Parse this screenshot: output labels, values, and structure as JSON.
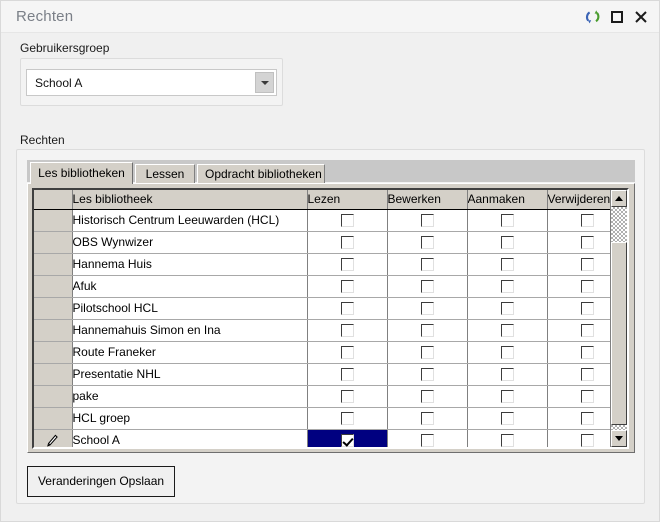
{
  "window": {
    "title": "Rechten",
    "controls": [
      {
        "name": "sync-icon",
        "label": "Sync"
      },
      {
        "name": "restore-icon",
        "label": "Restore"
      },
      {
        "name": "close-icon",
        "label": "Close"
      }
    ],
    "colors": {
      "title_text": "#7a7f87",
      "titlebar_bg": "#f5f5f5",
      "window_bg": "#f0f0f0",
      "panel_bg": "#f3f3f3",
      "tab_bg": "#d4d0c8",
      "selection_bg": "#000080",
      "sync_green": "#4a9c2e",
      "sync_blue": "#3a63b5"
    }
  },
  "usergroup": {
    "label": "Gebruikersgroep",
    "selected": "School A",
    "options": [
      "School A"
    ]
  },
  "rechten": {
    "label": "Rechten",
    "tabs": [
      {
        "label": "Les bibliotheken",
        "active": true
      },
      {
        "label": "Lessen",
        "active": false
      },
      {
        "label": "Opdracht bibliotheken",
        "active": false
      }
    ],
    "columns": [
      "Les bibliotheek",
      "Lezen",
      "Bewerken",
      "Aanmaken",
      "Verwijderen"
    ],
    "rows": [
      {
        "name": "Historisch Centrum Leeuwarden (HCL)",
        "lezen": false,
        "bewerken": false,
        "aanmaken": false,
        "verwijderen": false,
        "editing": false
      },
      {
        "name": "OBS Wynwizer",
        "lezen": false,
        "bewerken": false,
        "aanmaken": false,
        "verwijderen": false,
        "editing": false
      },
      {
        "name": "Hannema Huis",
        "lezen": false,
        "bewerken": false,
        "aanmaken": false,
        "verwijderen": false,
        "editing": false
      },
      {
        "name": "Afuk",
        "lezen": false,
        "bewerken": false,
        "aanmaken": false,
        "verwijderen": false,
        "editing": false
      },
      {
        "name": "Pilotschool HCL",
        "lezen": false,
        "bewerken": false,
        "aanmaken": false,
        "verwijderen": false,
        "editing": false
      },
      {
        "name": "Hannemahuis Simon en Ina",
        "lezen": false,
        "bewerken": false,
        "aanmaken": false,
        "verwijderen": false,
        "editing": false
      },
      {
        "name": "Route Franeker",
        "lezen": false,
        "bewerken": false,
        "aanmaken": false,
        "verwijderen": false,
        "editing": false
      },
      {
        "name": "Presentatie NHL",
        "lezen": false,
        "bewerken": false,
        "aanmaken": false,
        "verwijderen": false,
        "editing": false
      },
      {
        "name": "pake",
        "lezen": false,
        "bewerken": false,
        "aanmaken": false,
        "verwijderen": false,
        "editing": false
      },
      {
        "name": "HCL groep",
        "lezen": false,
        "bewerken": false,
        "aanmaken": false,
        "verwijderen": false,
        "editing": false
      },
      {
        "name": "School A",
        "lezen": true,
        "bewerken": false,
        "aanmaken": false,
        "verwijderen": false,
        "editing": true,
        "selected_cell": "lezen"
      }
    ]
  },
  "actions": {
    "save_label": "Veranderingen Opslaan"
  }
}
